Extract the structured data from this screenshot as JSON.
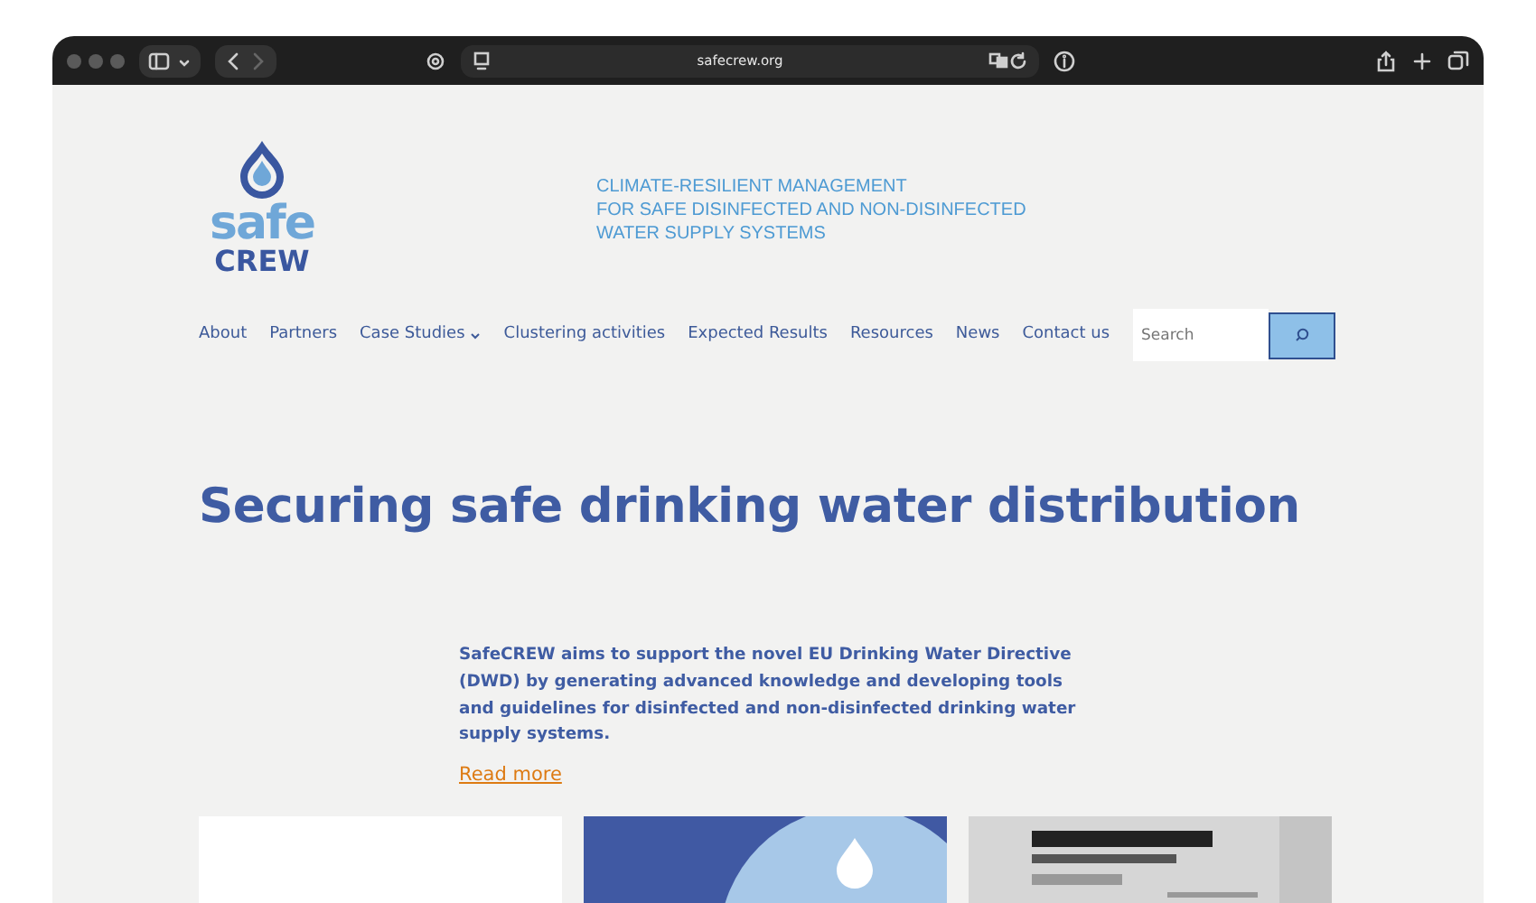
{
  "browser": {
    "url": "safecrew.org"
  },
  "logo": {
    "word_top": "safe",
    "word_bottom": "CREW"
  },
  "tagline": [
    "CLIMATE-RESILIENT MANAGEMENT",
    "FOR SAFE DISINFECTED AND NON-DISINFECTED",
    "WATER SUPPLY SYSTEMS"
  ],
  "nav": [
    {
      "label": "About",
      "has_dropdown": false
    },
    {
      "label": "Partners",
      "has_dropdown": false
    },
    {
      "label": "Case Studies",
      "has_dropdown": true
    },
    {
      "label": "Clustering activities",
      "has_dropdown": false
    },
    {
      "label": "Expected Results",
      "has_dropdown": false
    },
    {
      "label": "Resources",
      "has_dropdown": false
    },
    {
      "label": "News",
      "has_dropdown": false
    },
    {
      "label": "Contact us",
      "has_dropdown": false
    }
  ],
  "search": {
    "placeholder": "Search"
  },
  "hero_title": "Securing safe drinking water distribution",
  "intro": "SafeCREW aims to support the novel EU Drinking Water Directive (DWD) by generating advanced knowledge and developing tools and guidelines for disinfected and non-disinfected drinking water supply systems.",
  "read_more": "Read more",
  "cards": [
    {
      "kind": "blank"
    },
    {
      "kind": "picture"
    },
    {
      "kind": "picture"
    }
  ]
}
